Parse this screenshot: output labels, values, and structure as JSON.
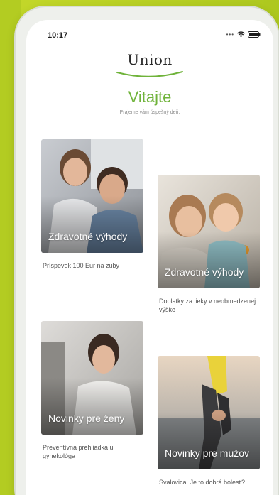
{
  "status_bar": {
    "time": "10:17"
  },
  "header": {
    "logo_text": "Union",
    "welcome_title": "Vitajte",
    "welcome_subtitle": "Prajeme vám úspešný deň."
  },
  "cards": [
    {
      "title": "Zdravotné výhody",
      "caption": "Príspevok 100 Eur na zuby"
    },
    {
      "title": "Zdravotné výhody",
      "caption": "Doplatky za lieky v neobmedzenej výške"
    },
    {
      "title": "Novinky pre ženy",
      "caption": "Preventívna prehliadka u gynekológa"
    },
    {
      "title": "Novinky pre mužov",
      "caption": "Svalovica. Je to dobrá bolesť?"
    }
  ],
  "colors": {
    "accent_green": "#6fb33a",
    "background_lime": "#b3cc22"
  },
  "icons": {
    "wifi": "wifi-icon",
    "battery": "battery-icon",
    "signal": "signal-icon"
  }
}
